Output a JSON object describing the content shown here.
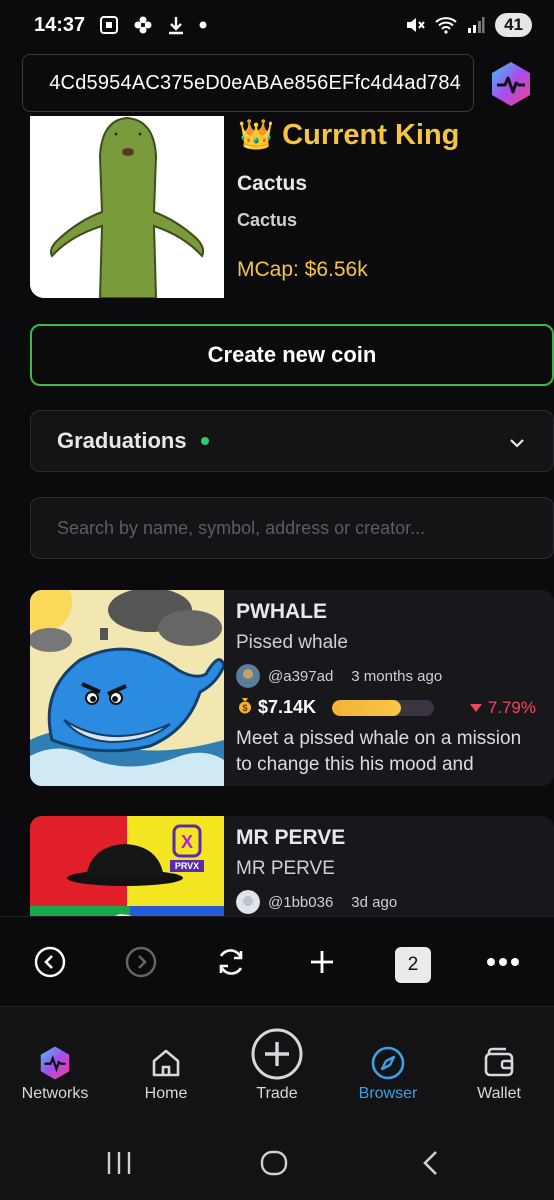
{
  "status_bar": {
    "time": "14:37",
    "battery": "41"
  },
  "browser": {
    "url": "4Cd5954AC375eD0eABAe856EFfc4d4ad784"
  },
  "king": {
    "title": "👑 Current King",
    "name": "Cactus",
    "symbol": "Cactus",
    "mcap": "MCap: $6.56k"
  },
  "create_button": "Create new coin",
  "graduations": {
    "label": "Graduations"
  },
  "search": {
    "placeholder": "Search by name, symbol, address or creator..."
  },
  "coins": [
    {
      "name": "PWHALE",
      "subtitle": "Pissed whale",
      "creator": "@a397ad",
      "time": "3 months ago",
      "mcap": "$7.14K",
      "progress": 0.68,
      "change": "7.79%",
      "description": "Meet a pissed whale on a mission to change this his mood and make…"
    },
    {
      "name": "MR PERVE",
      "subtitle": "MR PERVE",
      "creator": "@1bb036",
      "time": "3d ago",
      "badge": "PRVX"
    }
  ],
  "browser_toolbar": {
    "tab_count": "2"
  },
  "bottom_nav": {
    "items": [
      {
        "label": "Networks"
      },
      {
        "label": "Home"
      },
      {
        "label": "Trade"
      },
      {
        "label": "Browser"
      },
      {
        "label": "Wallet"
      }
    ],
    "active": "Browser"
  },
  "colors": {
    "gold": "#f5c542",
    "green": "#3db84a",
    "red": "#f0475b",
    "blue_active": "#3aa0e8"
  }
}
